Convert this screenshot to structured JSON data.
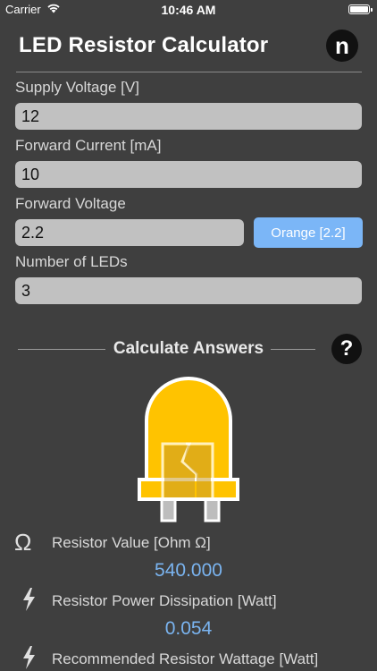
{
  "status": {
    "carrier": "Carrier",
    "time": "10:46 AM"
  },
  "header": {
    "title": "LED Resistor Calculator",
    "logo_letter": "n"
  },
  "inputs": {
    "supply_voltage": {
      "label": "Supply Voltage [V]",
      "value": "12"
    },
    "forward_current": {
      "label": "Forward Current [mA]",
      "value": "10"
    },
    "forward_voltage": {
      "label": "Forward Voltage",
      "value": "2.2"
    },
    "led_color_button": "Orange [2.2]",
    "num_leds": {
      "label": "Number of LEDs",
      "value": "3"
    }
  },
  "calculate": {
    "label": "Calculate Answers",
    "help": "?"
  },
  "led": {
    "body_color": "#FFC300",
    "outline": "#FFFFFF"
  },
  "results": {
    "resistor_value": {
      "icon": "ohm-icon",
      "label": "Resistor Value [Ohm Ω]",
      "value": "540.000"
    },
    "power_dissipation": {
      "icon": "lightning-icon",
      "label": "Resistor Power Dissipation [Watt]",
      "value": "0.054"
    },
    "recommended_wattage": {
      "icon": "lightning-icon",
      "label": "Recommended Resistor Wattage [Watt]"
    }
  },
  "colors": {
    "background": "#3F3F3F",
    "accent": "#7BB6F7",
    "input_bg": "#C1C1C1"
  }
}
